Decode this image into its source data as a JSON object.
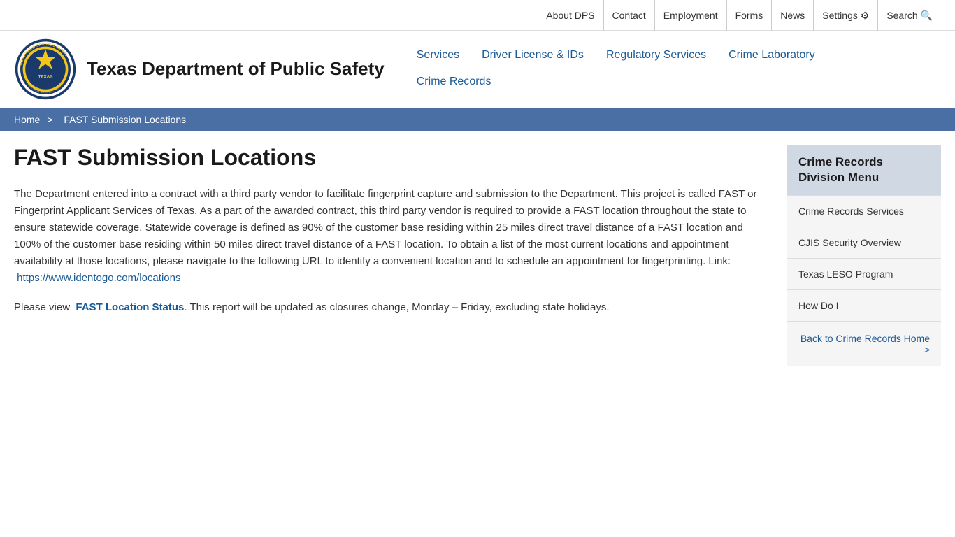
{
  "top_bar": {
    "links": [
      {
        "label": "About DPS",
        "name": "about-dps-link"
      },
      {
        "label": "Contact",
        "name": "contact-link"
      },
      {
        "label": "Employment",
        "name": "employment-link"
      },
      {
        "label": "Forms",
        "name": "forms-link"
      },
      {
        "label": "News",
        "name": "news-link"
      },
      {
        "label": "Settings ⚙",
        "name": "settings-link"
      },
      {
        "label": "Search 🔍",
        "name": "search-link"
      }
    ]
  },
  "header": {
    "agency_name": "Texas Department of Public Safety",
    "nav_row1": [
      {
        "label": "Services",
        "name": "nav-services"
      },
      {
        "label": "Driver License & IDs",
        "name": "nav-driver-license"
      },
      {
        "label": "Regulatory Services",
        "name": "nav-regulatory"
      },
      {
        "label": "Crime Laboratory",
        "name": "nav-crime-lab"
      }
    ],
    "nav_row2": [
      {
        "label": "Crime Records",
        "name": "nav-crime-records"
      }
    ]
  },
  "breadcrumb": {
    "home_label": "Home",
    "separator": ">",
    "current": "FAST Submission Locations"
  },
  "page": {
    "title": "FAST Submission Locations",
    "body_paragraph1": "The Department entered into a contract with a third party vendor to facilitate fingerprint capture and submission to the Department. This project is called FAST or Fingerprint Applicant Services of Texas.  As a part of the awarded contract, this third party vendor is required to provide a FAST location throughout the state to ensure statewide coverage.  Statewide coverage is defined as 90% of the customer base residing within 25 miles direct travel distance of a FAST location and 100% of the customer base residing within 50 miles direct travel distance of a FAST location. To obtain a list of the most current locations and appointment availability at those locations, please navigate to the following URL to identify a convenient location and to schedule an appointment for fingerprinting. Link:",
    "identogo_link": "https://www.identogo.com/locations",
    "body_paragraph2_pre": "Please view",
    "fast_location_link": "FAST Location Status",
    "body_paragraph2_post": ". This report will be updated as closures change, Monday – Friday, excluding state holidays."
  },
  "sidebar": {
    "title": "Crime Records Division Menu",
    "links": [
      {
        "label": "Crime Records Services",
        "name": "sidebar-crime-records-services"
      },
      {
        "label": "CJIS Security Overview",
        "name": "sidebar-cjis-security"
      },
      {
        "label": "Texas LESO Program",
        "name": "sidebar-texas-leso"
      },
      {
        "label": "How Do I",
        "name": "sidebar-how-do-i"
      }
    ],
    "back_link": "Back to Crime Records Home >"
  }
}
